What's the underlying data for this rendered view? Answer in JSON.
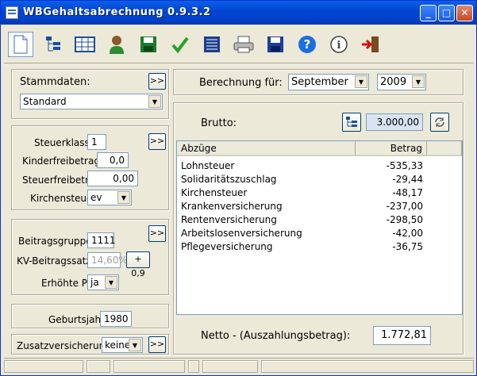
{
  "window": {
    "title": "WBGehaltsabrechnung 0.9.3.2",
    "min_label": "_",
    "max_label": "□",
    "close_label": "✕"
  },
  "toolbar": {
    "tools": [
      "new-document-icon",
      "tree-icon",
      "table-icon",
      "person-icon",
      "save-green-icon",
      "checkmark-icon",
      "list-icon",
      "printer-icon",
      "save-blue-icon",
      "help-icon",
      "info-icon",
      "exit-icon"
    ]
  },
  "stammdaten": {
    "label": "Stammdaten:",
    "more": ">>",
    "value": "Standard"
  },
  "steuer": {
    "klasse_label": "Steuerklasse:",
    "klasse": "1",
    "more": ">>",
    "kinder_label": "Kinderfreibetrag:",
    "kinder": "0,0",
    "frei_label": "Steuerfreibetrag:",
    "frei": "0,00",
    "kirche_label": "Kirchensteuer:",
    "kirche": "ev"
  },
  "beitrag": {
    "gruppe_label": "Beitragsgruppe:",
    "gruppe": "1111",
    "more": ">>",
    "kv_label": "KV-Beitragssatz:",
    "kv": "14,60%",
    "kv_btn": "+ 0,9",
    "pv_label": "Erhöhte PV:",
    "pv": "ja"
  },
  "geburt": {
    "label": "Geburtsjahr:",
    "value": "1980"
  },
  "zusatz": {
    "label": "Zusatzversicherung.:",
    "value": "keine",
    "more": ">>"
  },
  "berechnung": {
    "label": "Berechnung für:",
    "month": "September",
    "year": "2009"
  },
  "brutto": {
    "label": "Brutto:",
    "value": "3.000,00"
  },
  "abzuege": {
    "col1": "Abzüge",
    "col2": "Betrag",
    "rows": [
      {
        "name": "Lohnsteuer",
        "value": "-535,33"
      },
      {
        "name": "Solidaritätszuschlag",
        "value": "-29,44"
      },
      {
        "name": "Kirchensteuer",
        "value": "-48,17"
      },
      {
        "name": "Krankenversicherung",
        "value": "-237,00"
      },
      {
        "name": "Rentenversicherung",
        "value": "-298,50"
      },
      {
        "name": "Arbeitslosenversicherung",
        "value": "-42,00"
      },
      {
        "name": "Pflegeversicherung",
        "value": "-36,75"
      }
    ]
  },
  "netto": {
    "label": "Netto - (Auszahlungsbetrag):",
    "value": "1.772,81"
  }
}
